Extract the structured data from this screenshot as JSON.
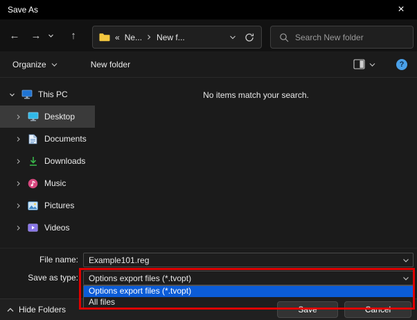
{
  "window": {
    "title": "Save As"
  },
  "glyphs": {
    "close": "×",
    "back": "←",
    "forward": "→",
    "up": "↑",
    "overflow": "«",
    "help": "?"
  },
  "toolbar": {
    "address": {
      "crumb1": "Ne...",
      "crumb2": "New f..."
    },
    "search": {
      "placeholder": "Search New folder"
    }
  },
  "commandbar": {
    "organize": "Organize",
    "new_folder": "New folder"
  },
  "sidebar": {
    "items": [
      {
        "label": "This PC"
      },
      {
        "label": "Desktop"
      },
      {
        "label": "Documents"
      },
      {
        "label": "Downloads"
      },
      {
        "label": "Music"
      },
      {
        "label": "Pictures"
      },
      {
        "label": "Videos"
      }
    ]
  },
  "main": {
    "empty_message": "No items match your search."
  },
  "fields": {
    "filename_label": "File name:",
    "filename_value": "Example101.reg",
    "savetype_label": "Save as type:",
    "savetype_value": "Options export files (*.tvopt)"
  },
  "dropdown": {
    "options": [
      "Options export files (*.tvopt)",
      "All files"
    ],
    "selected_index": 0
  },
  "footer": {
    "hide_folders": "Hide Folders",
    "save": "Save",
    "cancel": "Cancel"
  },
  "colors": {
    "selection_blue": "#0b5cd7",
    "annotation_red": "#e00000",
    "folder_yellow": "#f3c73f"
  }
}
